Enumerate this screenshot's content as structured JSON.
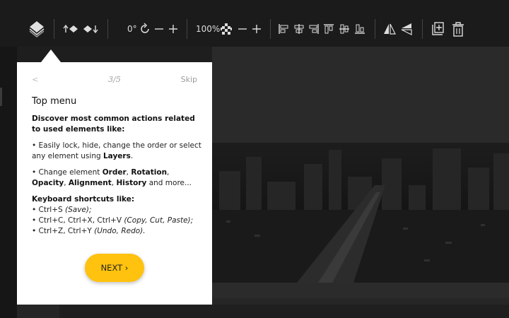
{
  "toolbar": {
    "rotation_value": "0°",
    "opacity_value": "100%"
  },
  "colors": {
    "toolbar_bg": "#1b1b1b",
    "panel_bg": "#ffffff",
    "accent": "#ffc20e",
    "canvas_bg": "#2a2a2a"
  },
  "icons": [
    "layers-icon",
    "move-up-icon",
    "move-down-icon",
    "rotate-icon",
    "minus-icon",
    "plus-icon",
    "opacity-checker-icon",
    "align-left-icon",
    "align-center-icon",
    "align-right-icon",
    "align-top-icon",
    "align-middle-icon",
    "align-bottom-icon",
    "flip-horizontal-icon",
    "flip-vertical-icon",
    "new-page-icon",
    "trash-icon"
  ],
  "tooltip": {
    "prev_label": "<",
    "step": "3/5",
    "skip_label": "Skip",
    "title": "Top menu",
    "intro": "Discover most common actions related to used elements like:",
    "p1_before": "• Easily lock, hide, change the order or select any element using ",
    "p1_bold": "Layers",
    "p1_after": ".",
    "p2_start": "• Change element ",
    "p2_b1": "Order",
    "p2_s1": ", ",
    "p2_b2": "Rotation",
    "p2_s2": ", ",
    "p2_b3": "Opacity",
    "p2_s3": ", ",
    "p2_b4": "Alignment",
    "p2_s4": ", ",
    "p2_b5": "History",
    "p2_end": " and more...",
    "shortcuts_title": "Keyboard shortcuts like:",
    "s1_keys": "• Ctrl+S ",
    "s1_desc": "(Save);",
    "s2_keys": "• Ctrl+C, Ctrl+X, Ctrl+V ",
    "s2_desc": "(Copy, Cut, Paste);",
    "s3_keys": "• Ctrl+Z, Ctrl+Y ",
    "s3_desc": "(Undo, Redo).",
    "next_label": "NEXT ›"
  }
}
